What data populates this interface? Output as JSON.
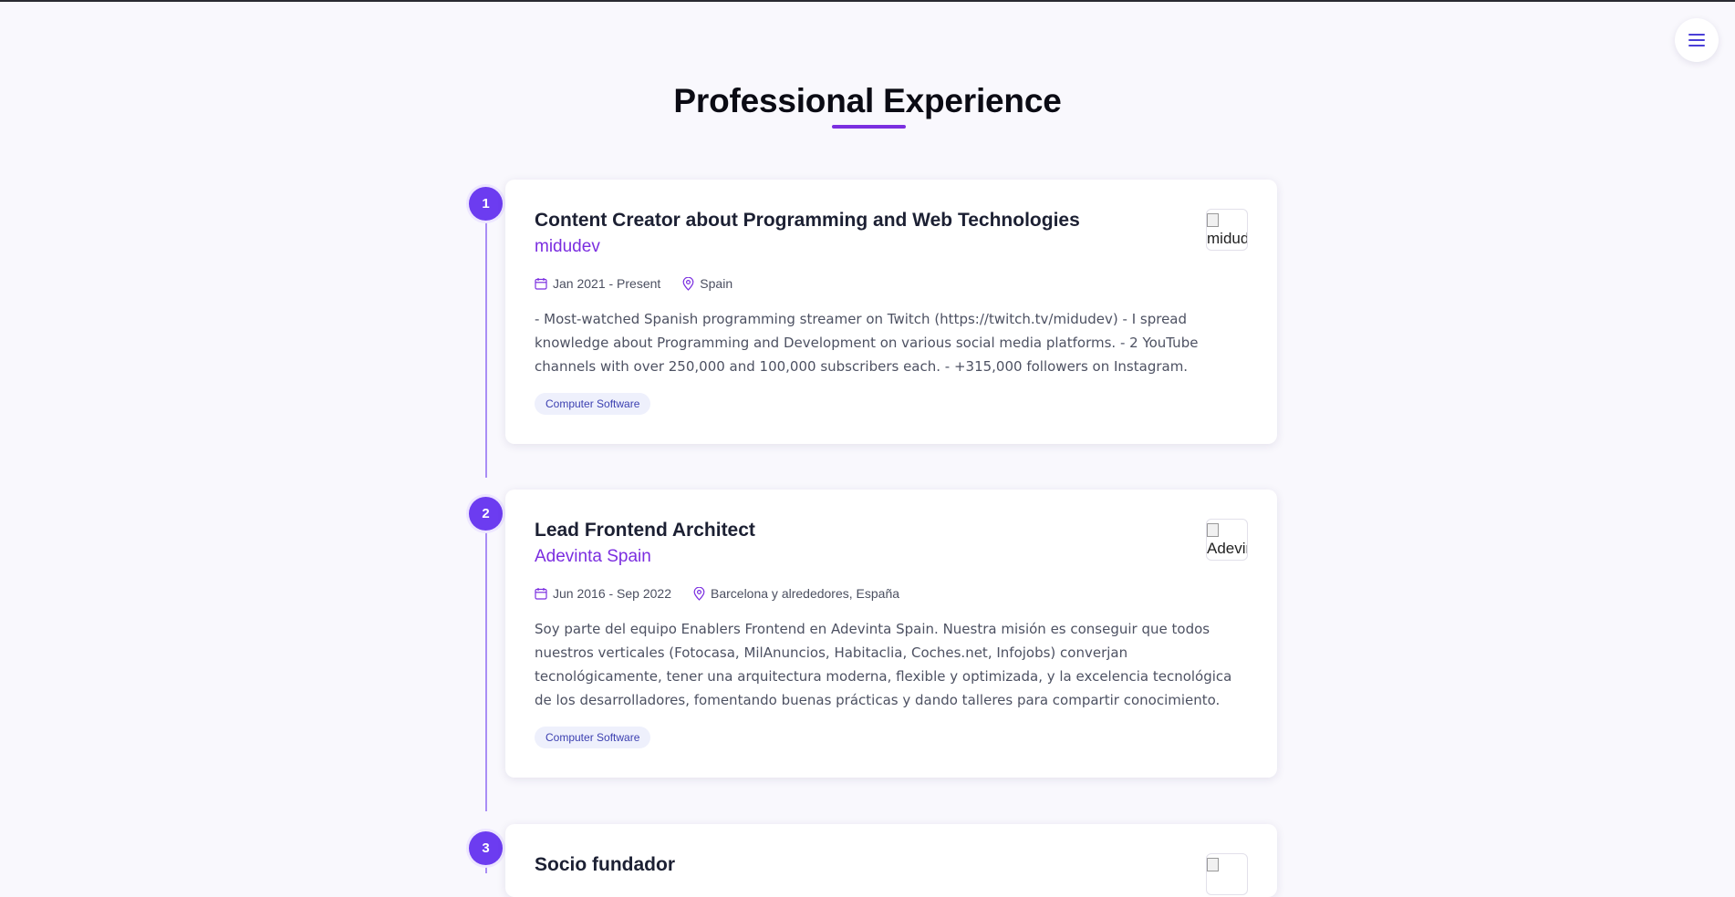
{
  "header": {
    "title": "Professional Experience",
    "menu_icon": "hamburger-menu-icon"
  },
  "accent_color": "#7b2fe0",
  "experiences": [
    {
      "number": "1",
      "role": "Content Creator about Programming and Web Technologies",
      "company": "midudev",
      "dates": "Jan 2021 - Present",
      "location": "Spain",
      "description": "- Most-watched Spanish programming streamer on Twitch (https://twitch.tv/midudev) - I spread knowledge about Programming and Development on various social media platforms. - 2 YouTube channels with over 250,000 and 100,000 subscribers each. - +315,000 followers on Instagram.",
      "tag": "Computer Software",
      "logo_alt": "midud"
    },
    {
      "number": "2",
      "role": "Lead Frontend Architect",
      "company": "Adevinta Spain",
      "dates": "Jun 2016 - Sep 2022",
      "location": "Barcelona y alrededores, España",
      "description": "Soy parte del equipo Enablers Frontend en Adevinta Spain. Nuestra misión es conseguir que todos nuestros verticales (Fotocasa, MilAnuncios, Habitaclia, Coches.net, Infojobs) converjan tecnológicamente, tener una arquitectura moderna, flexible y optimizada, y la excelencia tecnológica de los desarrolladores, fomentando buenas prácticas y dando talleres para compartir conocimiento.",
      "tag": "Computer Software",
      "logo_alt": "Adevir"
    },
    {
      "number": "3",
      "role": "Socio fundador"
    }
  ]
}
